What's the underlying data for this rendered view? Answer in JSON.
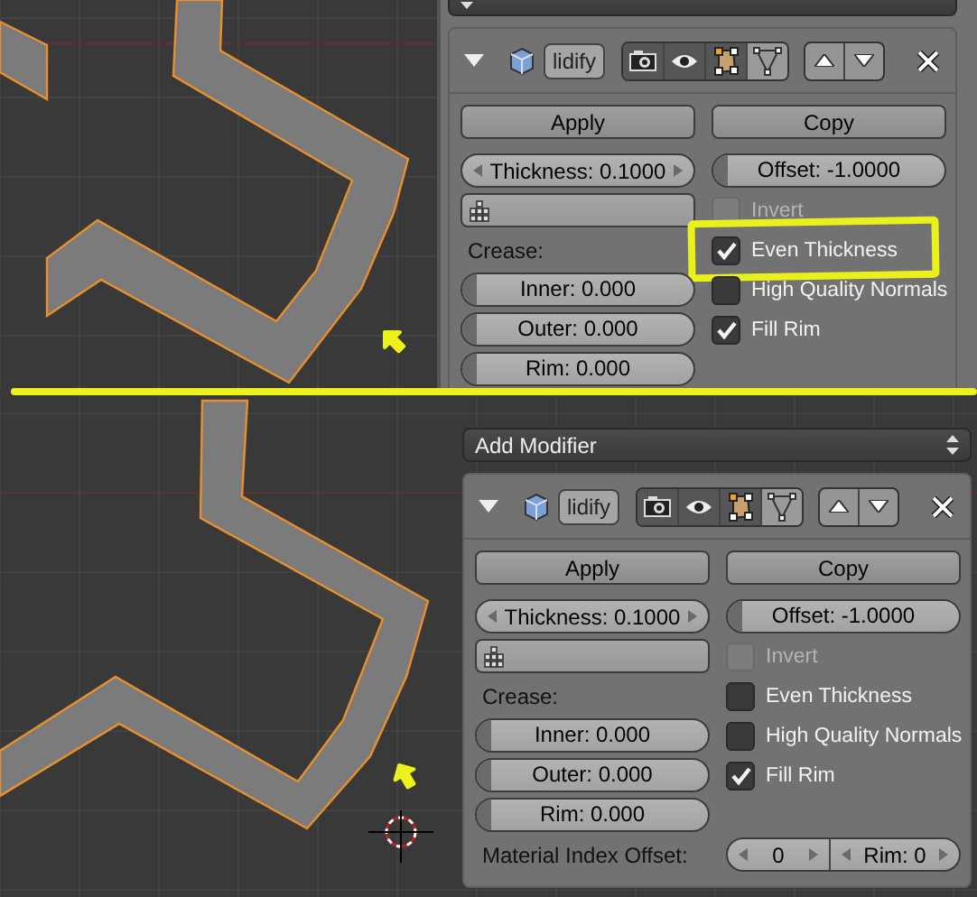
{
  "top": {
    "viewport": {
      "arrow": true
    },
    "panel": {
      "modifier": {
        "name": "lidify",
        "toggles": [
          {
            "kind": "render",
            "on": true
          },
          {
            "kind": "viewport",
            "on": true
          },
          {
            "kind": "editmode",
            "on": true
          },
          {
            "kind": "cage",
            "on": false
          }
        ]
      },
      "buttons": [
        "Apply",
        "Copy"
      ],
      "thickness": "Thickness: 0.1000",
      "offset": {
        "text": "Offset: -1.0000",
        "level": 0
      },
      "crease_label": "Crease:",
      "crease": [
        {
          "text": "Inner: 0.000",
          "level": 0
        },
        {
          "text": "Outer: 0.000",
          "level": 0
        },
        {
          "text": "Rim: 0.000",
          "level": 0
        }
      ],
      "options": [
        {
          "label": "Invert",
          "checked": false,
          "disabled": true,
          "highlighted": false
        },
        {
          "label": "Even Thickness",
          "checked": true,
          "disabled": false,
          "highlighted": true
        },
        {
          "label": "High Quality Normals",
          "checked": false,
          "disabled": false,
          "highlighted": false
        },
        {
          "label": "Fill Rim",
          "checked": true,
          "disabled": false,
          "highlighted": false
        }
      ]
    }
  },
  "bottom": {
    "viewport": {
      "arrow": true
    },
    "panel": {
      "title": "Add Modifier",
      "modifier": {
        "name": "lidify",
        "toggles": [
          {
            "kind": "render",
            "on": true
          },
          {
            "kind": "viewport",
            "on": true
          },
          {
            "kind": "editmode",
            "on": true
          },
          {
            "kind": "cage",
            "on": false
          }
        ]
      },
      "buttons": [
        "Apply",
        "Copy"
      ],
      "thickness": "Thickness: 0.1000",
      "offset": {
        "text": "Offset: -1.0000",
        "level": 0
      },
      "crease_label": "Crease:",
      "crease": [
        {
          "text": "Inner: 0.000",
          "level": 0
        },
        {
          "text": "Outer: 0.000",
          "level": 0
        },
        {
          "text": "Rim: 0.000",
          "level": 0
        }
      ],
      "options": [
        {
          "label": "Invert",
          "checked": false,
          "disabled": true,
          "highlighted": false
        },
        {
          "label": "Even Thickness",
          "checked": false,
          "disabled": false,
          "highlighted": false
        },
        {
          "label": "High Quality Normals",
          "checked": false,
          "disabled": false,
          "highlighted": false
        },
        {
          "label": "Fill Rim",
          "checked": true,
          "disabled": false,
          "highlighted": false
        }
      ],
      "material_index": {
        "label": "Material Index Offset:",
        "value": "0",
        "rim": "Rim: 0"
      }
    }
  }
}
